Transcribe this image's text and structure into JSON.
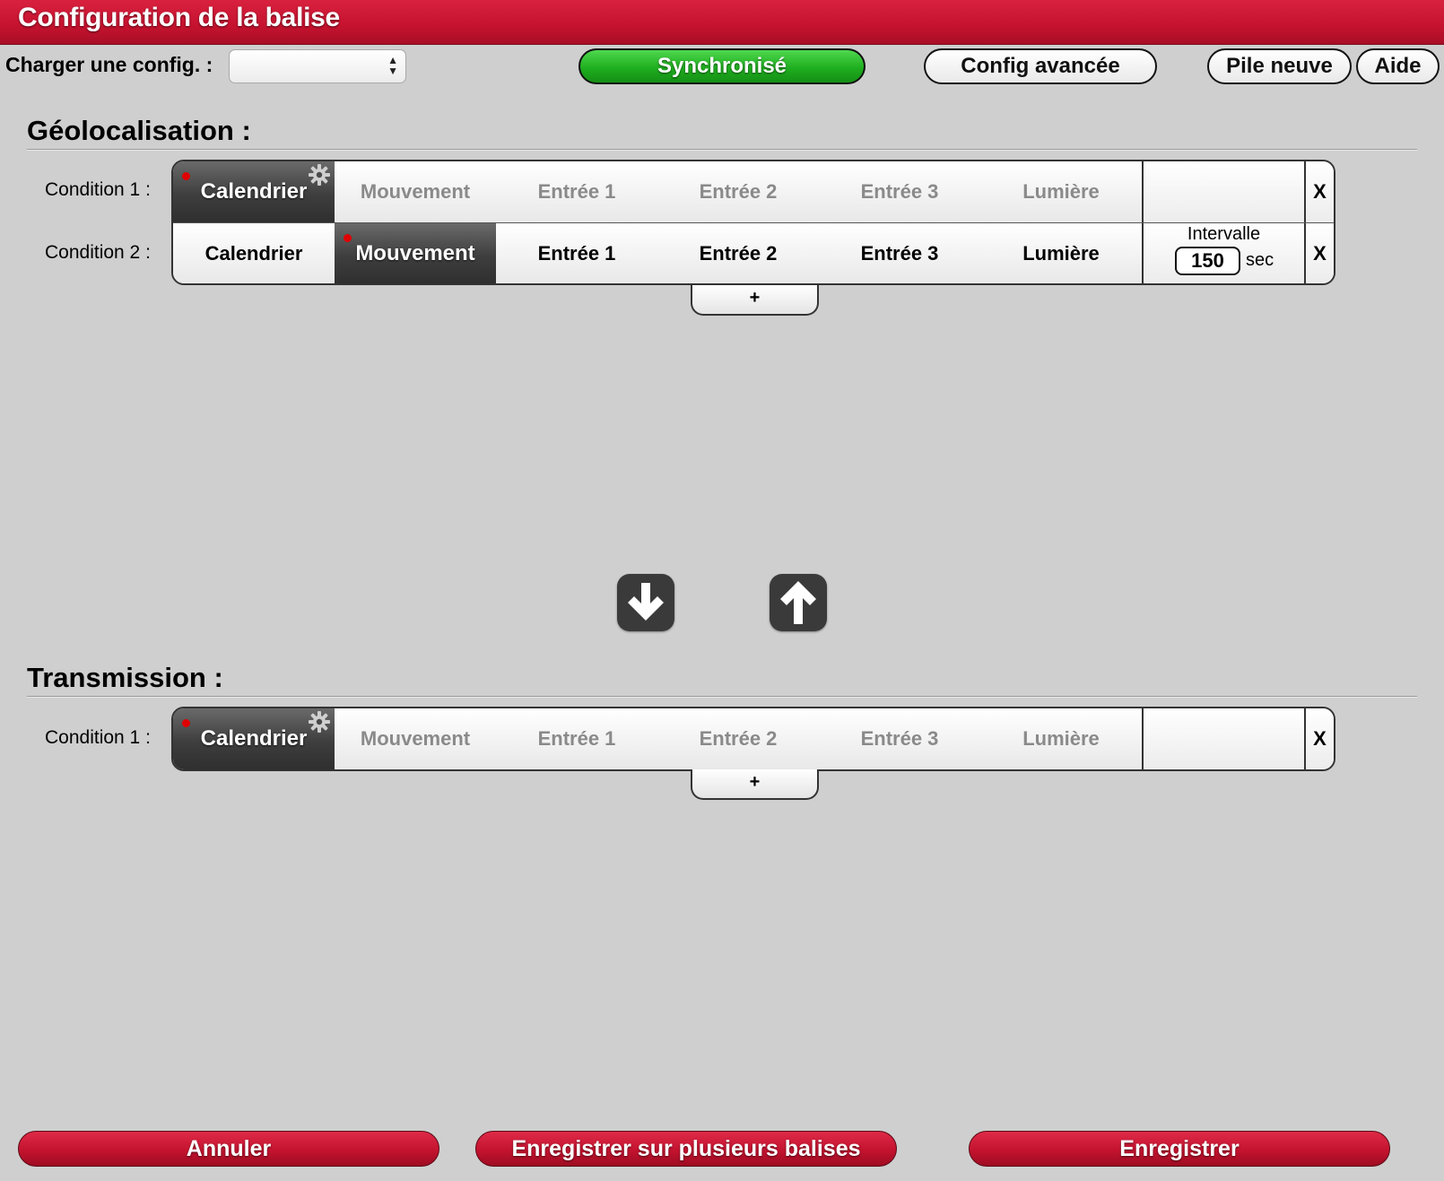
{
  "header": {
    "title": "Configuration de la balise"
  },
  "toolbar": {
    "load_config_label": "Charger une config. :",
    "load_config_value": "",
    "sync_label": "Synchronisé",
    "advanced_label": "Config avancée",
    "new_battery_label": "Pile neuve",
    "help_label": "Aide"
  },
  "geolocation": {
    "title": "Géolocalisation :",
    "conditions": [
      {
        "label": "Condition 1 :",
        "active": "Calendrier",
        "inactive_style": "dim"
      },
      {
        "label": "Condition 2 :",
        "active": "Mouvement",
        "inactive_style": "normal",
        "interval_label": "Intervalle",
        "interval_value": "150",
        "interval_unit": "sec"
      }
    ],
    "add_label": "+"
  },
  "transmission": {
    "title": "Transmission :",
    "conditions": [
      {
        "label": "Condition 1 :",
        "active": "Calendrier",
        "inactive_style": "dim"
      }
    ],
    "add_label": "+"
  },
  "trigger_options": [
    "Calendrier",
    "Mouvement",
    "Entrée 1",
    "Entrée 2",
    "Entrée 3",
    "Lumière"
  ],
  "remove_label": "X",
  "footer": {
    "cancel_label": "Annuler",
    "save_multi_label": "Enregistrer sur plusieurs balises",
    "save_label": "Enregistrer"
  },
  "icons": {
    "settings": "gear-icon",
    "move_down": "arrow-down-icon",
    "move_up": "arrow-up-icon"
  },
  "colors": {
    "brand_red": "#c5122f",
    "sync_green": "#1fae1f",
    "active_dark": "#3e3e3e",
    "indicator_red": "#e00000"
  }
}
